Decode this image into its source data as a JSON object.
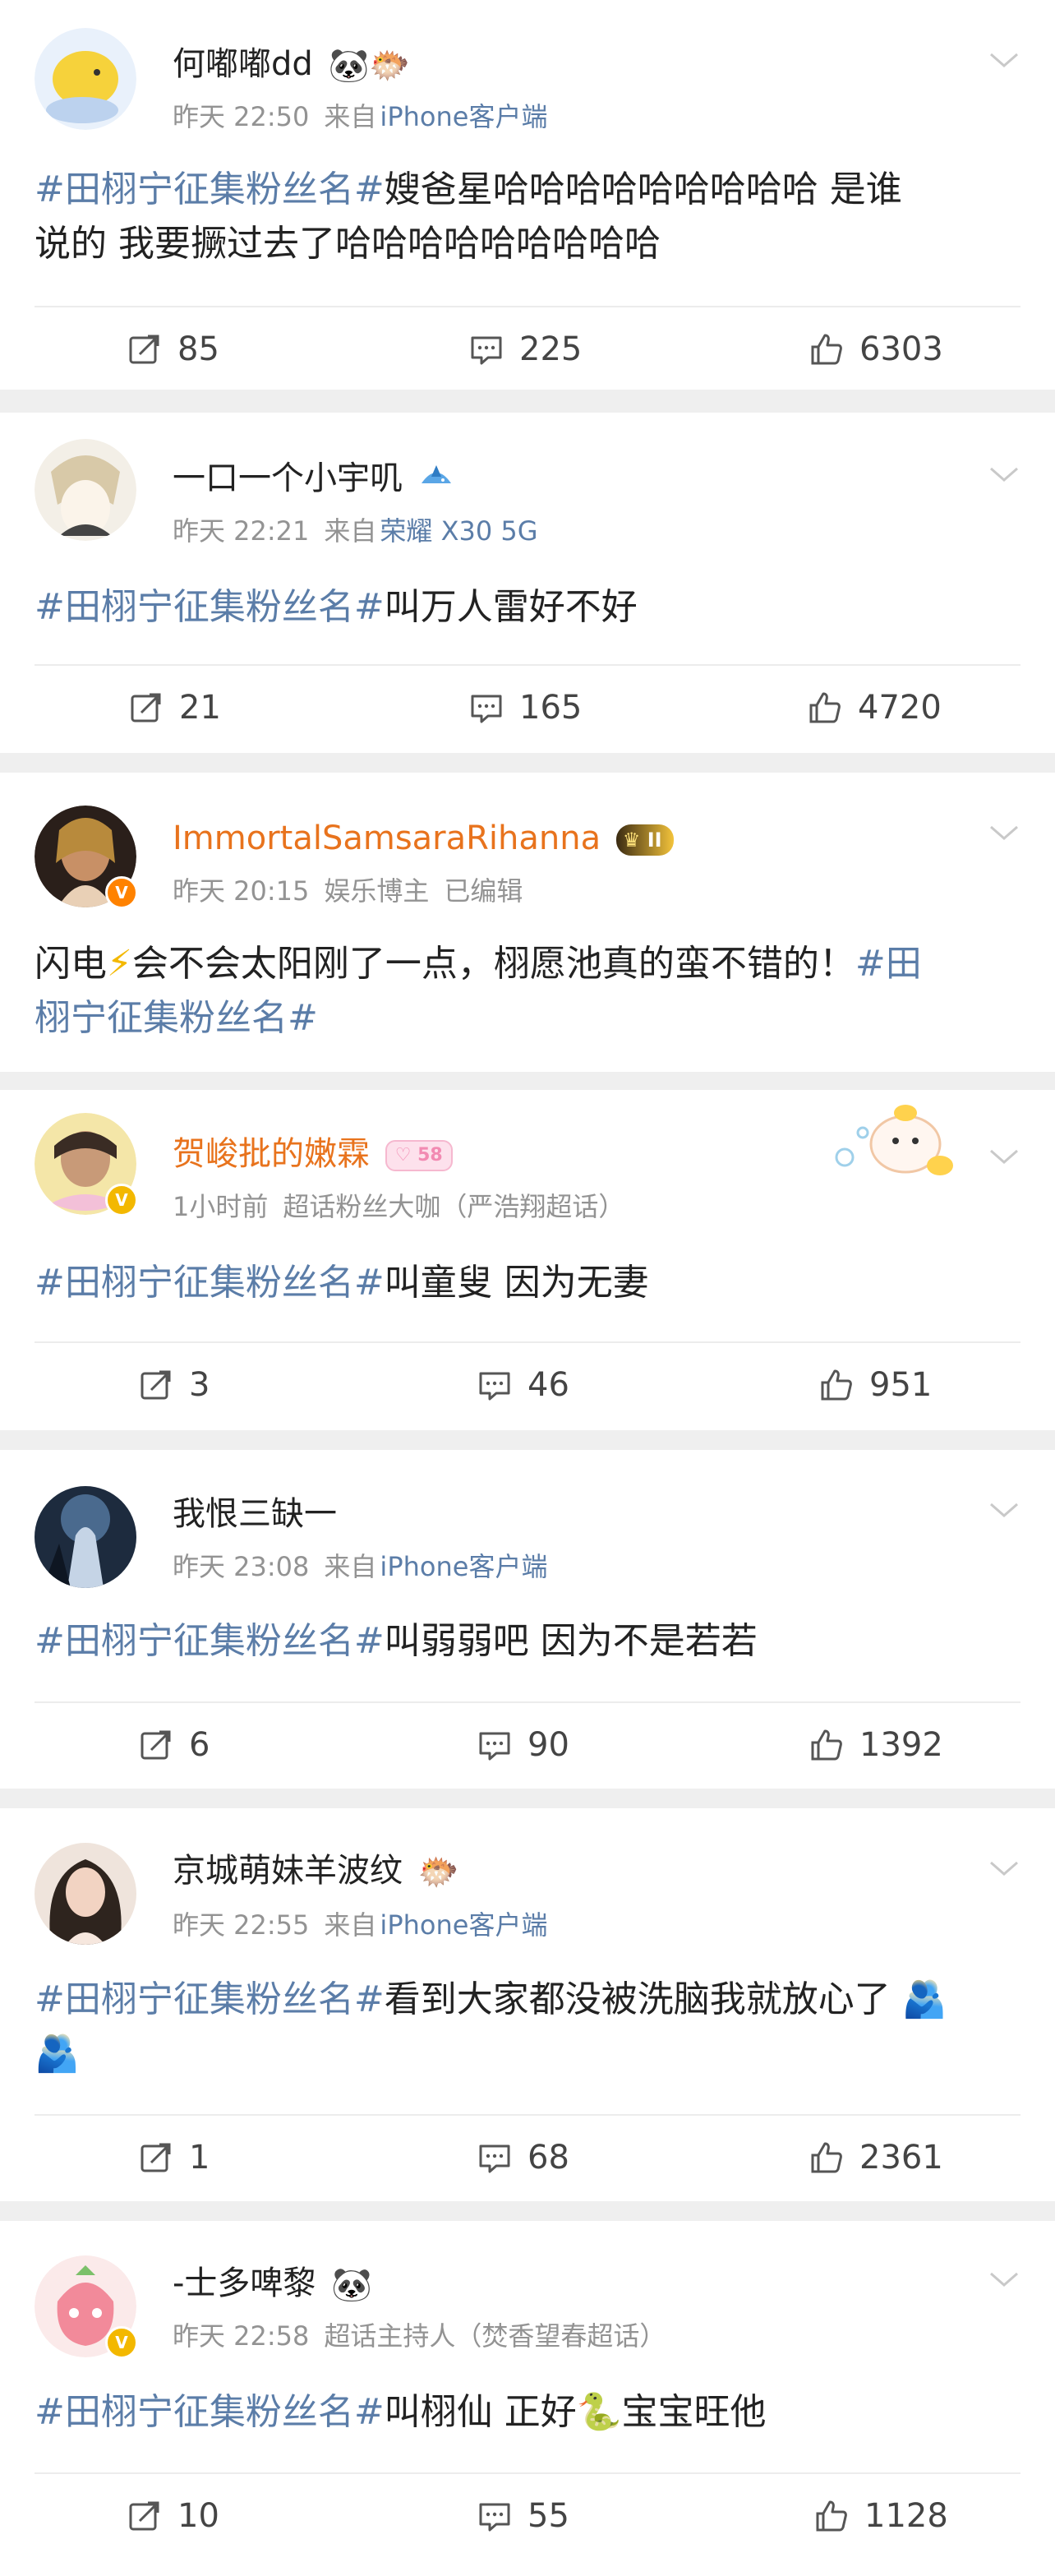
{
  "posts": [
    {
      "username": "何嘟嘟dd",
      "name_emojis": "🐼🐡",
      "time": "昨天 22:50",
      "source_prefix": "来自",
      "source": "iPhone客户端",
      "hashtag": "#田栩宁征集粉丝名#",
      "line1_rest": "嫂爸星哈哈哈哈哈哈哈哈哈 是谁",
      "line2": "说的 我要撅过去了哈哈哈哈哈哈哈哈哈",
      "reposts": "85",
      "comments": "225",
      "likes": "6303"
    },
    {
      "username": "一口一个小宇叽",
      "time": "昨天 22:21",
      "source_prefix": "来自",
      "source": "荣耀 X30 5G",
      "hashtag": "#田栩宁征集粉丝名#",
      "text_rest": "叫万人雷好不好",
      "reposts": "21",
      "comments": "165",
      "likes": "4720"
    },
    {
      "username": "ImmortalSamsaraRihanna",
      "level": "II",
      "time": "昨天 20:15",
      "role": "娱乐博主",
      "edited": "已编辑",
      "line1_a": "闪电",
      "line1_emoji": "⚡",
      "line1_b": "会不会太阳刚了一点，栩愿池真的蛮不错的！",
      "hashtag_a": "#田",
      "hashtag_b": "栩宁征集粉丝名#"
    },
    {
      "username": "贺峻批的嫩霖",
      "level_badge": "58",
      "time": "1小时前",
      "role": "超话粉丝大咖（严浩翔超话）",
      "hashtag": "#田栩宁征集粉丝名#",
      "text_rest": "叫童叟 因为无妻",
      "reposts": "3",
      "comments": "46",
      "likes": "951"
    },
    {
      "username": "我恨三缺一",
      "time": "昨天 23:08",
      "source_prefix": "来自",
      "source": "iPhone客户端",
      "hashtag": "#田栩宁征集粉丝名#",
      "text_rest": "叫弱弱吧 因为不是若若",
      "reposts": "6",
      "comments": "90",
      "likes": "1392"
    },
    {
      "username": "京城萌妹羊波纹",
      "name_emojis": "🐡",
      "time": "昨天 22:55",
      "source_prefix": "来自",
      "source": "iPhone客户端",
      "hashtag": "#田栩宁征集粉丝名#",
      "text_rest": "看到大家都没被洗脑我就放心了",
      "emoji": "🫂",
      "reposts": "1",
      "comments": "68",
      "likes": "2361"
    },
    {
      "username": "-士多啤黎",
      "name_emojis": "🐼",
      "time": "昨天 22:58",
      "role": "超话主持人（焚香望春超话）",
      "hashtag": "#田栩宁征集粉丝名#",
      "text_a": "叫栩仙  正好",
      "snake": "🐍",
      "text_b": "宝宝旺他",
      "reposts": "10",
      "comments": "55",
      "likes": "1128"
    }
  ],
  "icons": {
    "repost": "repost-icon",
    "comment": "comment-icon",
    "like": "thumbs-up-icon",
    "more": "chevron-down-icon",
    "verified": "verified-badge-icon"
  },
  "colors": {
    "hashtag": "#5b7da8",
    "vip_name": "#e8731d",
    "meta": "#939393",
    "background": "#efefef"
  }
}
